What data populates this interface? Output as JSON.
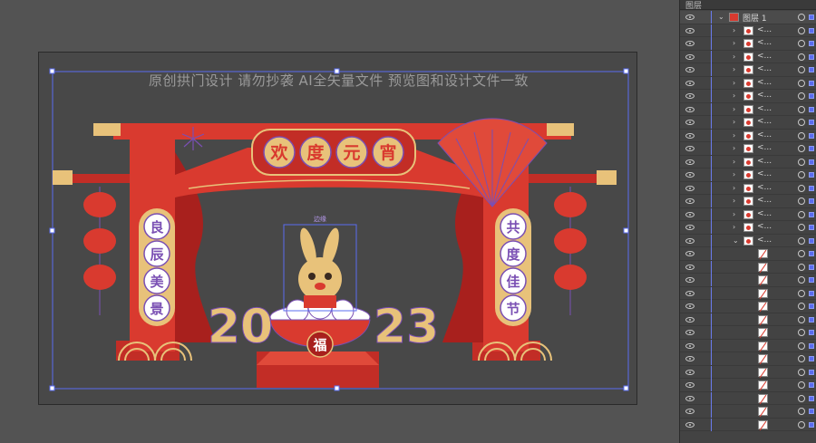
{
  "canvas": {
    "banner_text": "原创拱门设计    请勿抄袭   AI全矢量文件 预览图和设计文件一致",
    "arch_title_chars": [
      "欢",
      "度",
      "元",
      "宵"
    ],
    "left_pillar_chars": [
      "良",
      "辰",
      "美",
      "景"
    ],
    "right_pillar_chars": [
      "共",
      "度",
      "佳",
      "节"
    ],
    "bowl_char": "福",
    "year_left": "20",
    "year_right": "23",
    "selection_label": "边缘"
  },
  "colors": {
    "red": "#d93a2f",
    "dark_red": "#a8201d",
    "gold": "#e8c27a",
    "purple": "#7a4fb3",
    "selection_blue": "#5a6cf0"
  },
  "layers_panel": {
    "tab_label": "图层",
    "top_layer_name": "图层 1",
    "sub_layer_label": "<...",
    "rows": 32
  }
}
